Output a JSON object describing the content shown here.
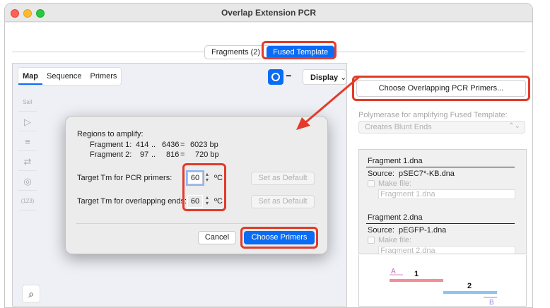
{
  "window": {
    "title": "Overlap Extension PCR"
  },
  "tabs": [
    {
      "label": "Fragments (2)",
      "active": false
    },
    {
      "label": "Fused Template",
      "active": true
    }
  ],
  "left_panel": {
    "subtabs": [
      {
        "label": "Map",
        "active": true
      },
      {
        "label": "Sequence",
        "active": false
      },
      {
        "label": "Primers",
        "active": false
      }
    ],
    "display_label": "Display",
    "tools": [
      "SalI",
      "→",
      "≡",
      "⇄",
      "◎",
      "(123)"
    ],
    "search_icon": "search-icon"
  },
  "dialog": {
    "regions_label": "Regions to amplify:",
    "fragments": [
      {
        "name": "Fragment 1:",
        "start": "414",
        "sep": "..",
        "end": "6436",
        "eq": "=",
        "size": "6023 bp"
      },
      {
        "name": "Fragment 2:",
        "start": "97",
        "sep": "..",
        "end": "816",
        "eq": "=",
        "size": "720 bp"
      }
    ],
    "pcr_tm_label": "Target Tm for PCR primers:",
    "pcr_tm_value": "60",
    "overlap_tm_label": "Target Tm for overlapping ends:",
    "overlap_tm_value": "60",
    "unit": "ºC",
    "set_default_label": "Set as Default",
    "cancel_label": "Cancel",
    "choose_label": "Choose Primers"
  },
  "right_panel": {
    "choose_button_label": "Choose Overlapping PCR Primers...",
    "polymerase_label": "Polymerase for amplifying Fused Template:",
    "polymerase_value": "Creates Blunt Ends",
    "fragment_list": [
      {
        "title": "Fragment 1.dna",
        "source_label": "Source:",
        "source": "pSEC7*-KB.dna",
        "make_file_label": "Make file:",
        "file_name": "Fragment 1.dna"
      },
      {
        "title": "Fragment 2.dna",
        "source_label": "Source:",
        "source": "pEGFP-1.dna",
        "make_file_label": "Make file:",
        "file_name": "Fragment 2.dna"
      }
    ],
    "diagram": {
      "label_1": "1",
      "label_2": "2",
      "primer_a": "A",
      "primer_b": "B",
      "color_fragment_1": "#f08f95",
      "color_fragment_2": "#8fc3f0"
    }
  },
  "colors": {
    "accent": "#0a6cf5",
    "highlight": "#e23b2a"
  }
}
